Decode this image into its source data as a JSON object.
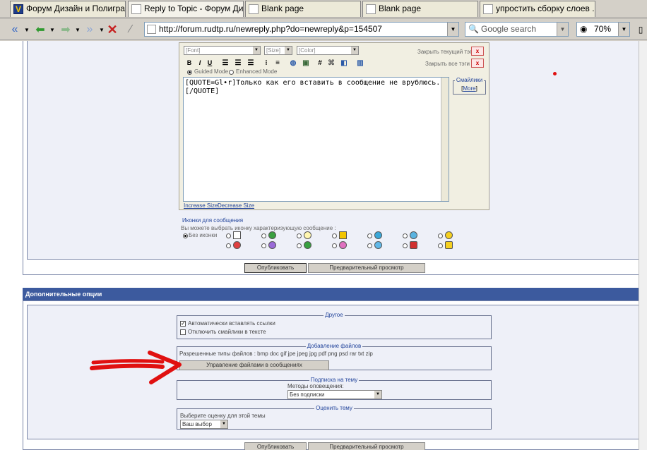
{
  "tabs": [
    {
      "label": "Форум Дизайн и Полигра..."
    },
    {
      "label": "Reply to Topic - Форум Ди..."
    },
    {
      "label": "Blank page"
    },
    {
      "label": "Blank page"
    },
    {
      "label": "упростить сборку слоев ..."
    }
  ],
  "nav": {
    "url": "http://forum.rudtp.ru/newreply.php?do=newreply&p=154507",
    "search_placeholder": "Google search",
    "zoom": "70%"
  },
  "editor": {
    "font_placeholder": "[Font]",
    "size_placeholder": "[Size]",
    "color_placeholder": "[Color]",
    "close_current_tag": "Закрыть текущий тэг",
    "close_all_tags": "Закрыть все тэги",
    "close_x": "x",
    "bold": "B",
    "italic": "I",
    "underline": "U",
    "mode_guided": "Guided Mode",
    "mode_enhanced": "Enhanced Mode",
    "message_line1": "[QUOTE=Gl•r]Только как его вставить в сообщение не врублюсь... Ка",
    "message_line2": "[/QUOTE]",
    "smilies_title": "Смайлики",
    "smilies_more": "More",
    "increase_size": "Increase Size",
    "decrease_size": "Decrease Size"
  },
  "post_icons": {
    "title": "Иконки для сообщения",
    "hint": "Вы можете выбрать иконку характеризующую сообщение :",
    "no_icon": "Без иконки"
  },
  "buttons": {
    "publish": "Опубликовать",
    "preview": "Предварительный просмотр"
  },
  "extra_options": {
    "header": "Дополнительные опции",
    "other_legend": "Другое",
    "auto_links": "Автоматически вставлять ссылки",
    "disable_smilies": "Отключить смайлики в тексте",
    "attach_legend": "Добавление файлов",
    "allowed_types": "Разрешенные типы файлов : bmp doc gif jpe jpeg jpg pdf png psd rar txt zip",
    "manage_files": "Управление файлами в сообщениях",
    "subscribe_legend": "Подписка на тему",
    "notify_method_label": "Методы оповещения:",
    "notify_method_value": "Без подписки",
    "rate_legend": "Оценить тему",
    "rate_label": "Выберите оценку для этой темы",
    "rate_value": "Ваш выбор"
  },
  "colors": {
    "arrow": "#e01010",
    "header_bg": "#3c5a9e",
    "panel_bg": "#eef0f8"
  }
}
